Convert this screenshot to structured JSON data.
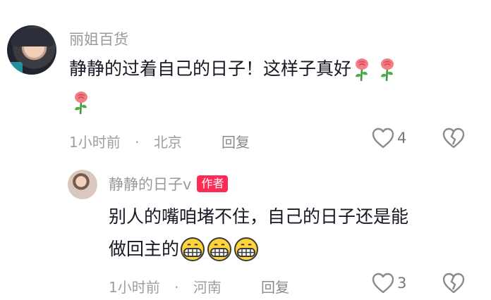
{
  "comment": {
    "username": "丽姐百货",
    "text_line1": "静静的过着自己的日子！这样子真好",
    "time": "1小时前",
    "location": "北京",
    "reply_label": "回复",
    "like_count": "4"
  },
  "reply": {
    "username": "静静的日子v",
    "author_tag": "作者",
    "text_line1": "别人的嘴咱堵不住，自己的日子还是能",
    "text_line2": "做回主的",
    "time": "1小时前",
    "location": "河南",
    "reply_label": "回复",
    "like_count": "3"
  },
  "separator": "·",
  "icons": {
    "rose": "rose-emoji-icon",
    "grin": "grinning-face-emoji-icon",
    "like": "heart-outline-icon",
    "dislike": "broken-heart-icon"
  },
  "colors": {
    "author_tag_bg": "#fe2c55",
    "text": "#161823",
    "meta": "#9e9e9e"
  }
}
